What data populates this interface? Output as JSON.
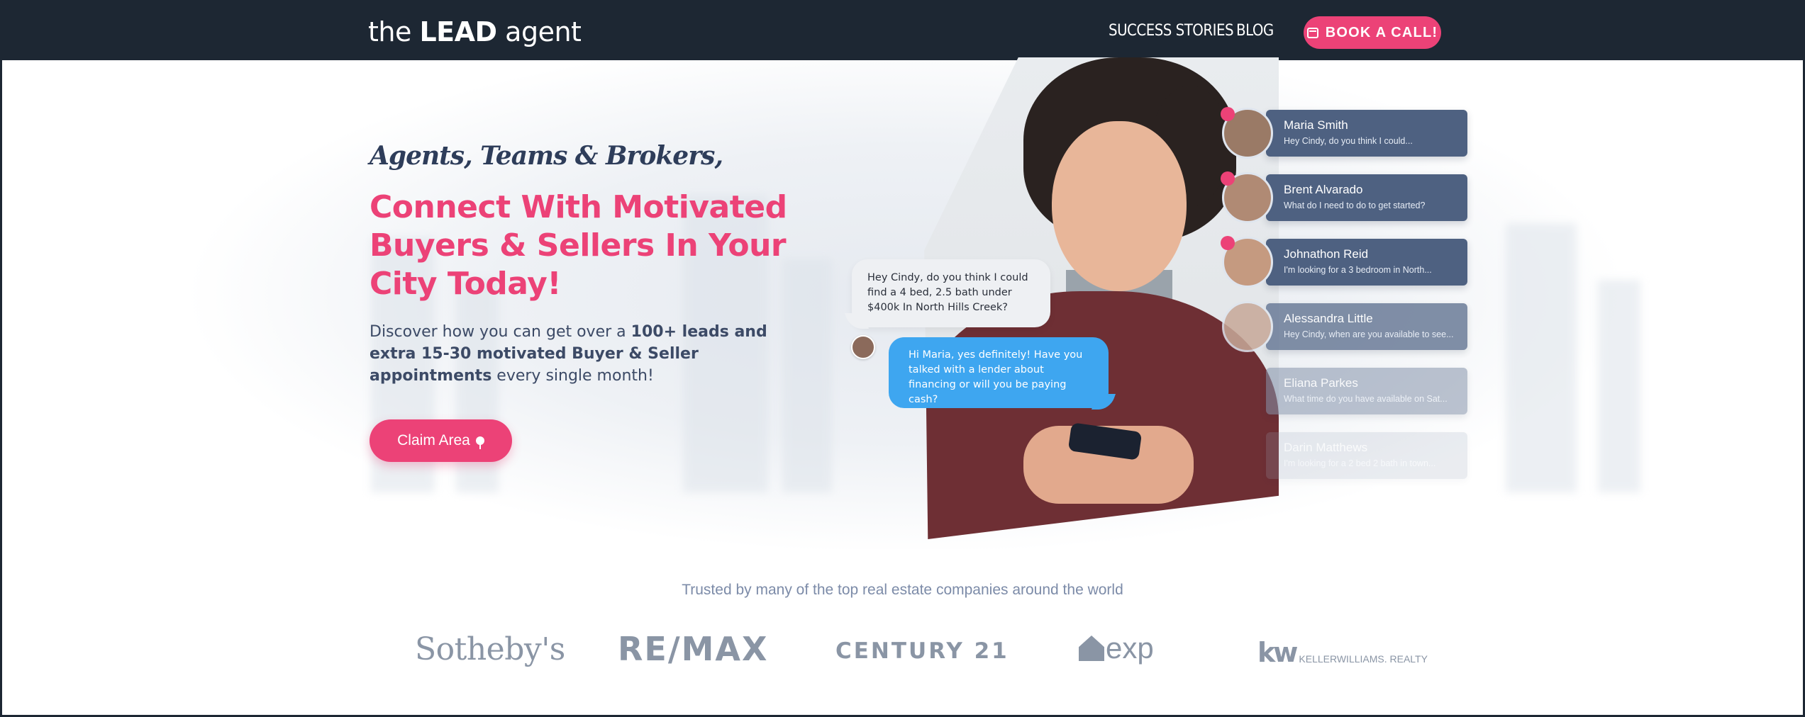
{
  "nav": {
    "logo_prefix": "the ",
    "logo_brand": "LEAD",
    "logo_suffix": " agent",
    "links": [
      "SUCCESS STORIES",
      "BLOG"
    ],
    "cta": "BOOK A CALL!"
  },
  "hero": {
    "kicker": "Agents, Teams & Brokers,",
    "headline": "Connect With Motivated Buyers & Sellers In Your City Today!",
    "desc_1": "Discover how you can get over a ",
    "desc_bold": "100+ leads and extra 15-30 motivated Buyer & Seller appointments",
    "desc_2": " every single month!",
    "cta": "Claim Area"
  },
  "chat": {
    "incoming": "Hey Cindy, do you think I could find a 4 bed, 2.5 bath under $400k In North Hills Creek?",
    "outgoing": "Hi Maria, yes definitely! Have you talked with a lender about financing or will you be paying cash?"
  },
  "contacts": [
    {
      "name": "Maria Smith",
      "message": "Hey Cindy, do you think I could...",
      "unread": true
    },
    {
      "name": "Brent Alvarado",
      "message": "What do I need to do to get started?",
      "unread": true
    },
    {
      "name": "Johnathon Reid",
      "message": "I'm looking for a 3 bedroom in North...",
      "unread": true
    },
    {
      "name": "Alessandra Little",
      "message": "Hey Cindy, when are you available to see...",
      "unread": false
    },
    {
      "name": "Eliana Parkes",
      "message": "What time do you have available on Sat...",
      "unread": false
    },
    {
      "name": "Darin Matthews",
      "message": "I'm looking for a 2 bed 2 bath in town...",
      "unread": false
    }
  ],
  "trusted": {
    "title": "Trusted by many of the top real estate companies around the world",
    "logos": {
      "sothebys": "Sotheby's",
      "remax": "RE/MAX",
      "century21": "CENTURY 21",
      "exp": "exp",
      "kw_mark": "kw",
      "kw_text": "KELLERWILLIAMS. REALTY"
    }
  },
  "colors": {
    "nav_bg": "#1d2733",
    "accent": "#ec4277",
    "card": "#4e6181",
    "bubble_blue": "#3ea6f0"
  }
}
